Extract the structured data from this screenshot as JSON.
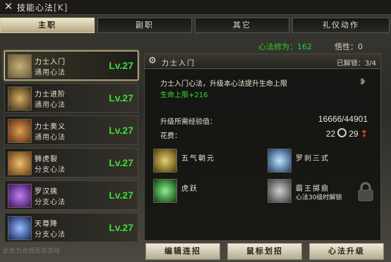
{
  "window": {
    "title": "技能心法",
    "hotkey": "[K]"
  },
  "tabs": [
    "主职",
    "副职",
    "其它",
    "礼仪动作"
  ],
  "points": {
    "text": "心法修为：162",
    "wuxing": "悟性：0"
  },
  "skills": [
    {
      "name": "力士入门",
      "cat": "通用心法",
      "lv": "Lv.27",
      "selected": true,
      "icon": "fist-icon",
      "color": "#8a7c5a"
    },
    {
      "name": "力士进阶",
      "cat": "通用心法",
      "lv": "Lv.27",
      "selected": false,
      "icon": "sword-slash-icon",
      "color": "#6b5a3a"
    },
    {
      "name": "力士奥义",
      "cat": "通用心法",
      "lv": "Lv.27",
      "selected": false,
      "icon": "warrior-icon",
      "color": "#8a4a20"
    },
    {
      "name": "狮虎裂",
      "cat": "分支心法",
      "lv": "Lv.27",
      "selected": false,
      "icon": "beast-icon",
      "color": "#a0702a"
    },
    {
      "name": "罗汉擒",
      "cat": "分支心法",
      "lv": "Lv.27",
      "selected": false,
      "icon": "purple-grab-icon",
      "color": "#6a3a9a"
    },
    {
      "name": "天尊降",
      "cat": "分支心法",
      "lv": "Lv.27",
      "selected": false,
      "icon": "blue-strike-icon",
      "color": "#2a4a9a"
    }
  ],
  "detail": {
    "name": "力士入门",
    "unlocked": "已解锁：3/4",
    "desc": "力士入门心法，升级本心法提升生命上限",
    "gain": "生命上限+216",
    "req_label": "升级所需经验值：",
    "req_value": "16666/44901",
    "cost_label": "花费：",
    "cost_a": "22",
    "cost_b": "29",
    "subskills": [
      {
        "name": "五气朝元",
        "note": "",
        "icon": "buddha-icon",
        "color": "#7a6a20"
      },
      {
        "name": "罗刹三式",
        "note": "",
        "icon": "blue-swirl-icon",
        "color": "#2a5a8a"
      },
      {
        "name": "虎跃",
        "note": "",
        "icon": "green-leap-icon",
        "color": "#2a6a2a"
      },
      {
        "name": "霸王掷鼎",
        "note": "心法30级时解锁",
        "icon": "cauldron-icon",
        "color": "#5a5a5a"
      }
    ]
  },
  "buttons": [
    "编辑连招",
    "鼠标划招",
    "心法升级"
  ],
  "footer": "此处为合成而非游戏"
}
